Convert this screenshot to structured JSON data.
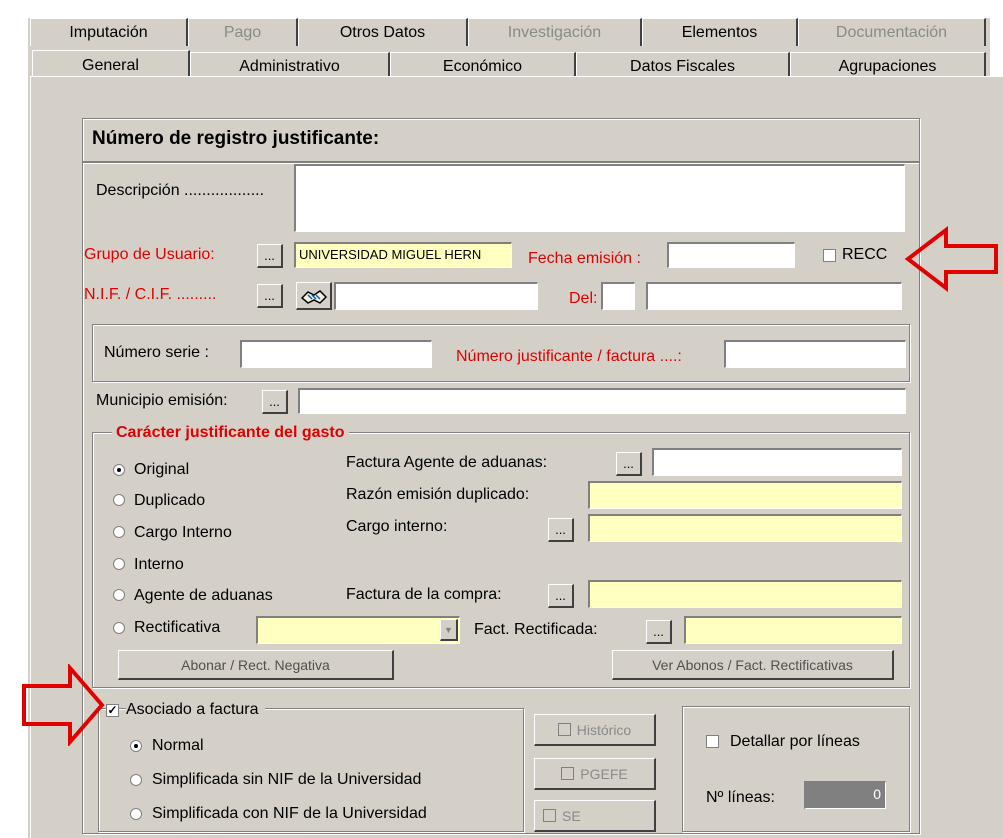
{
  "tabs_row1": [
    {
      "label": "Imputación",
      "disabled": false
    },
    {
      "label": "Pago",
      "disabled": true
    },
    {
      "label": "Otros Datos",
      "disabled": false
    },
    {
      "label": "Investigación",
      "disabled": true
    },
    {
      "label": "Elementos",
      "disabled": false
    },
    {
      "label": "Documentación",
      "disabled": true
    }
  ],
  "tabs_row2": [
    {
      "label": "General",
      "selected": true
    },
    {
      "label": "Administrativo"
    },
    {
      "label": "Económico"
    },
    {
      "label": "Datos Fiscales"
    },
    {
      "label": "Agrupaciones"
    }
  ],
  "header": {
    "title": "Número de registro justificante:"
  },
  "form": {
    "descripcion_label": "Descripción ..................",
    "descripcion_value": "",
    "grupo_label": "Grupo de Usuario:",
    "grupo_value": "UNIVERSIDAD MIGUEL HERN",
    "fecha_label": "Fecha emisión :",
    "fecha_value": "",
    "recc_label": "RECC",
    "nif_label": "N.I.F. / C.I.F. .........",
    "nif_value": "",
    "del_label": "Del:",
    "del_value1": "",
    "del_value2": "",
    "numero_serie_label": "Número serie :",
    "numero_serie_value": "",
    "num_justificante_label": "Número justificante / factura ....:",
    "num_justificante_value": "",
    "municipio_label": "Municipio emisión:",
    "municipio_value": "",
    "dots_label": "..."
  },
  "caracter": {
    "title": "Carácter justificante del gasto",
    "options": [
      "Original",
      "Duplicado",
      "Cargo Interno",
      "Interno",
      "Agente de aduanas",
      "Rectificativa"
    ],
    "selected": "Original",
    "factura_agente_label": "Factura Agente de aduanas:",
    "razon_duplicado_label": "Razón emisión duplicado:",
    "cargo_interno_label": "Cargo interno:",
    "factura_compra_label": "Factura de la compra:",
    "fact_rectificada_label": "Fact. Rectificada:",
    "abonar_button": "Abonar / Rect. Negativa",
    "ver_abonos_button": "Ver Abonos / Fact. Rectificativas"
  },
  "asociado": {
    "label": "Asociado a factura",
    "checked": true,
    "options": [
      "Normal",
      "Simplificada sin NIF de la Universidad",
      "Simplificada con NIF de la Universidad"
    ],
    "selected": "Normal"
  },
  "flags": {
    "historico": "Histórico",
    "pgefe": "PGEFE",
    "se": "SE"
  },
  "detalle": {
    "label": "Detallar por líneas",
    "num_lineas_label": "Nº líneas:",
    "num_lineas_value": "0"
  },
  "colors": {
    "accent_red": "#e00000",
    "yellow_field": "#ffffc0",
    "face": "#d4d0c8"
  }
}
